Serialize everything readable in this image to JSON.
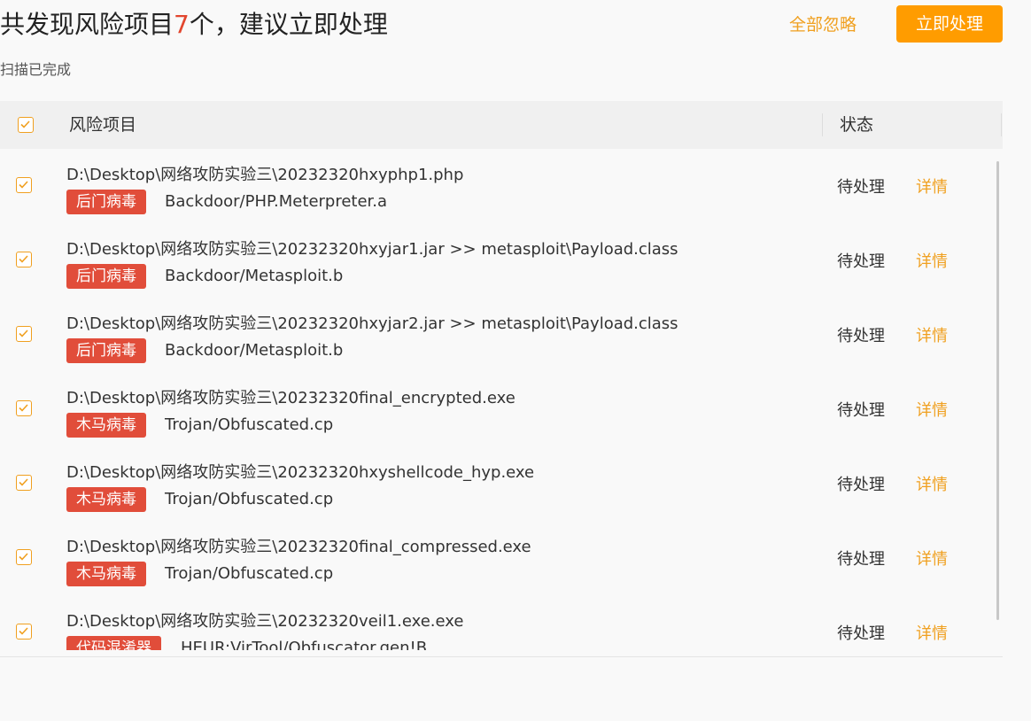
{
  "header": {
    "title_prefix": "共发现风险项目",
    "title_count": "7",
    "title_suffix": "个，建议立即处理",
    "subtitle": "扫描已完成",
    "ignore_all_label": "全部忽略",
    "process_label": "立即处理"
  },
  "table": {
    "col_risk": "风险项目",
    "col_status": "状态"
  },
  "rows": [
    {
      "path": "D:\\Desktop\\网络攻防实验三\\20232320hxyphp1.php",
      "tag": "后门病毒",
      "virus": "Backdoor/PHP.Meterpreter.a",
      "status": "待处理",
      "detail": "详情"
    },
    {
      "path": "D:\\Desktop\\网络攻防实验三\\20232320hxyjar1.jar >> metasploit\\Payload.class",
      "tag": "后门病毒",
      "virus": "Backdoor/Metasploit.b",
      "status": "待处理",
      "detail": "详情"
    },
    {
      "path": "D:\\Desktop\\网络攻防实验三\\20232320hxyjar2.jar >> metasploit\\Payload.class",
      "tag": "后门病毒",
      "virus": "Backdoor/Metasploit.b",
      "status": "待处理",
      "detail": "详情"
    },
    {
      "path": "D:\\Desktop\\网络攻防实验三\\20232320final_encrypted.exe",
      "tag": "木马病毒",
      "virus": "Trojan/Obfuscated.cp",
      "status": "待处理",
      "detail": "详情"
    },
    {
      "path": "D:\\Desktop\\网络攻防实验三\\20232320hxyshellcode_hyp.exe",
      "tag": "木马病毒",
      "virus": "Trojan/Obfuscated.cp",
      "status": "待处理",
      "detail": "详情"
    },
    {
      "path": "D:\\Desktop\\网络攻防实验三\\20232320final_compressed.exe",
      "tag": "木马病毒",
      "virus": "Trojan/Obfuscated.cp",
      "status": "待处理",
      "detail": "详情"
    },
    {
      "path": "D:\\Desktop\\网络攻防实验三\\20232320veil1.exe.exe",
      "tag": "代码混淆器",
      "virus": "HEUR:VirTool/Obfuscator.gen!B",
      "status": "待处理",
      "detail": "详情"
    }
  ],
  "colors": {
    "accent": "#ff9c00",
    "link": "#f0a020",
    "tag_bg": "#e14d3a",
    "count": "#e2462e"
  },
  "icons": {
    "checkbox": "checkbox-checked-icon"
  }
}
